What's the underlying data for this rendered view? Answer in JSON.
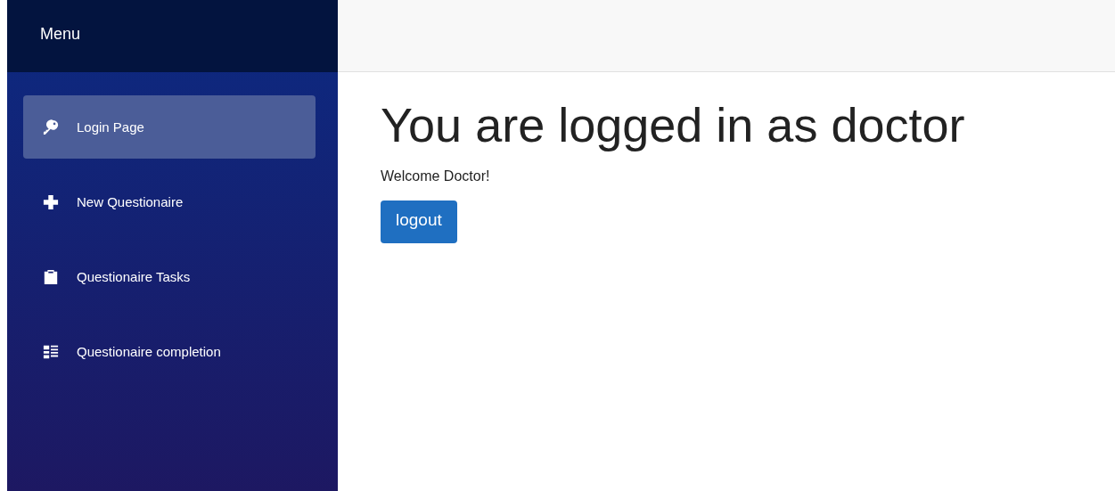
{
  "sidebar": {
    "title": "Menu",
    "items": [
      {
        "label": "Login Page",
        "selected": true
      },
      {
        "label": "New Questionaire",
        "selected": false
      },
      {
        "label": "Questionaire Tasks",
        "selected": false
      },
      {
        "label": "Questionaire completion",
        "selected": false
      }
    ]
  },
  "main": {
    "heading": "You are logged in as doctor",
    "message": "Welcome Doctor!",
    "button": "logout"
  }
}
